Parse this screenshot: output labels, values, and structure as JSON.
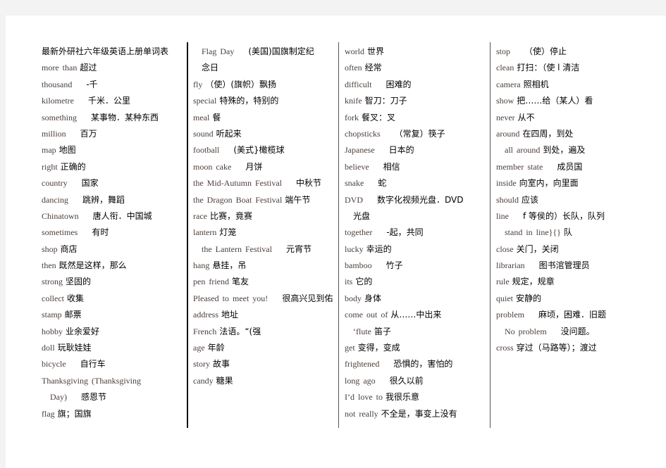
{
  "document": {
    "title": "最新外研社六年级英语上册单词表",
    "columns": [
      {
        "entries": [
          {
            "en": "more than",
            "zh": "超过",
            "gap": 0
          },
          {
            "en": "thousand",
            "zh": "-千",
            "gap": 2
          },
          {
            "en": "kilometre",
            "zh": "千米．公里",
            "gap": 2
          },
          {
            "en": "something",
            "zh": "某事物．某种东西",
            "gap": 2
          },
          {
            "en": "million",
            "zh": "百万",
            "gap": 2
          },
          {
            "en": "map",
            "zh": "地图",
            "gap": 0
          },
          {
            "en": "right",
            "zh": "正确的",
            "gap": 0
          },
          {
            "en": "country",
            "zh": "国家",
            "gap": 2
          },
          {
            "en": "dancing",
            "zh": "跳辨，舞蹈",
            "gap": 2
          },
          {
            "en": "Chinatown",
            "zh": "唐人衔．中国城",
            "gap": 2
          },
          {
            "en": "sometimes",
            "zh": "有时",
            "gap": 2
          },
          {
            "en": "shop",
            "zh": "商店",
            "gap": 0
          },
          {
            "en": "then",
            "zh": "既然是这样，那么",
            "gap": 0
          },
          {
            "en": "strong",
            "zh": "坚固的",
            "gap": 0
          },
          {
            "en": "collect",
            "zh": "收集",
            "gap": 0
          },
          {
            "en": "stamp",
            "zh": "邮票",
            "gap": 0
          },
          {
            "en": "hobby",
            "zh": "业余爱好",
            "gap": 0
          },
          {
            "en": "doll",
            "zh": "玩耿娃娃",
            "gap": 0
          },
          {
            "en": "bicycle",
            "zh": "自行车",
            "gap": 2
          },
          {
            "en": "Thanksgiving (Thanksgiving",
            "zh": "",
            "gap": 0
          },
          {
            "en": "Day)",
            "zh": "感恩节",
            "gap": 2,
            "indent": true
          },
          {
            "en": "flag",
            "zh": "旗；国旗",
            "gap": 0
          }
        ]
      },
      {
        "entries": [
          {
            "en": "Flag Day",
            "zh": "(美国)国旗制定纪",
            "gap": 2,
            "indent": true
          },
          {
            "en": "",
            "zh": "念日",
            "gap": 0,
            "indent": true
          },
          {
            "en": "fly",
            "zh": "（使）(旗帜）飘扬",
            "gap": 0
          },
          {
            "en": "special",
            "zh": "特殊的，特别的",
            "gap": 0
          },
          {
            "en": "meal",
            "zh": "餐",
            "gap": 0
          },
          {
            "en": "sound",
            "zh": "听起来",
            "gap": 0
          },
          {
            "en": "football",
            "zh": "(美式}橄榄球",
            "gap": 2
          },
          {
            "en": "moon cake",
            "zh": "月饼",
            "gap": 2
          },
          {
            "en": "the Mid-Autumn Festival",
            "zh": "中秋节",
            "gap": 2
          },
          {
            "en": "the Dragon Boat Festival",
            "zh": "端午节",
            "gap": 0
          },
          {
            "en": "race",
            "zh": "比赛，竟赛",
            "gap": 0
          },
          {
            "en": "lantern",
            "zh": "灯笼",
            "gap": 0
          },
          {
            "en": "the Lantern Festival",
            "zh": "元宵节",
            "gap": 2,
            "indent": true
          },
          {
            "en": "hang",
            "zh": "悬挂，吊",
            "gap": 0
          },
          {
            "en": "pen friend",
            "zh": "笔友",
            "gap": 0
          },
          {
            "en": "Pleased to meet you!",
            "zh": "很高兴见到佑",
            "gap": 2
          },
          {
            "en": "address",
            "zh": "地址",
            "gap": 0
          },
          {
            "en": "French",
            "zh": "法语。“(强",
            "gap": 0
          },
          {
            "en": "age",
            "zh": "年龄",
            "gap": 0
          },
          {
            "en": "story",
            "zh": "故事",
            "gap": 0
          },
          {
            "en": "candy",
            "zh": "糖果",
            "gap": 0
          }
        ]
      },
      {
        "entries": [
          {
            "en": "world",
            "zh": "世界",
            "gap": 0
          },
          {
            "en": "often",
            "zh": "经常",
            "gap": 0
          },
          {
            "en": "difficult",
            "zh": "困难的",
            "gap": 2
          },
          {
            "en": "knife",
            "zh": "智刀：刀子",
            "gap": 0
          },
          {
            "en": "fork",
            "zh": "餐叉：叉",
            "gap": 0
          },
          {
            "en": "chopsticks",
            "zh": "（常复）筷子",
            "gap": 2
          },
          {
            "en": "Japanese",
            "zh": "日本的",
            "gap": 2
          },
          {
            "en": "believe",
            "zh": "相信",
            "gap": 2
          },
          {
            "en": "snake",
            "zh": "蛇",
            "gap": 2
          },
          {
            "en": "DVD",
            "zh": "数字化视频光盘．DVD",
            "gap": 2
          },
          {
            "en": "",
            "zh": "光盘",
            "gap": 0,
            "indent": true
          },
          {
            "en": "together",
            "zh": "-起，共同",
            "gap": 2
          },
          {
            "en": "lucky",
            "zh": "幸运的",
            "gap": 0
          },
          {
            "en": "bamboo",
            "zh": "竹子",
            "gap": 2
          },
          {
            "en": "its",
            "zh": "它的",
            "gap": 0
          },
          {
            "en": "body",
            "zh": "身体",
            "gap": 0
          },
          {
            "en": "come out of",
            "zh": "从……中出来",
            "gap": 0
          },
          {
            "en": "‘flute",
            "zh": "笛子",
            "gap": 0,
            "indent": true
          },
          {
            "en": "get",
            "zh": "变得，变成",
            "gap": 0
          },
          {
            "en": "frightened",
            "zh": "恐惧的，害怕的",
            "gap": 2
          },
          {
            "en": "long ago",
            "zh": "很久以前",
            "gap": 2
          },
          {
            "en": "I’d love to",
            "zh": "我很乐意",
            "gap": 0
          },
          {
            "en": "not really",
            "zh": "不全是，事变上没有",
            "gap": 0
          }
        ]
      },
      {
        "entries": [
          {
            "en": "stop",
            "zh": "（使）停止",
            "gap": 2
          },
          {
            "en": "clean",
            "zh": "打扫：（使 l 清洁",
            "gap": 0
          },
          {
            "en": "camera",
            "zh": "照相机",
            "gap": 0
          },
          {
            "en": "show",
            "zh": "把……给（某人）看",
            "gap": 0
          },
          {
            "en": "never",
            "zh": "从不",
            "gap": 0
          },
          {
            "en": "around",
            "zh": "在四周，到处",
            "gap": 0
          },
          {
            "en": "all around",
            "zh": "到处，遍及",
            "gap": 0,
            "indent": true
          },
          {
            "en": "member state",
            "zh": "成员国",
            "gap": 2
          },
          {
            "en": "inside",
            "zh": "向室内，向里面",
            "gap": 0
          },
          {
            "en": "should",
            "zh": "应该",
            "gap": 0
          },
          {
            "en": "line",
            "zh": "f 等侯的）长队，队列",
            "gap": 2
          },
          {
            "en": "stand in line}{}",
            "zh": "队",
            "gap": 0,
            "indent": true
          },
          {
            "en": "close",
            "zh": "关门，关闭",
            "gap": 0
          },
          {
            "en": "librarian",
            "zh": "图书涫管理员",
            "gap": 2
          },
          {
            "en": "rule",
            "zh": "规定，规章",
            "gap": 0
          },
          {
            "en": "quiet",
            "zh": "安静的",
            "gap": 0
          },
          {
            "en": "problem",
            "zh": "麻顷，困难．旧题",
            "gap": 2
          },
          {
            "en": "No problem",
            "zh": "没问题。",
            "gap": 2,
            "indent": true
          },
          {
            "en": "cross",
            "zh": "穿过（马路等）；渡过",
            "gap": 0
          }
        ]
      }
    ]
  }
}
